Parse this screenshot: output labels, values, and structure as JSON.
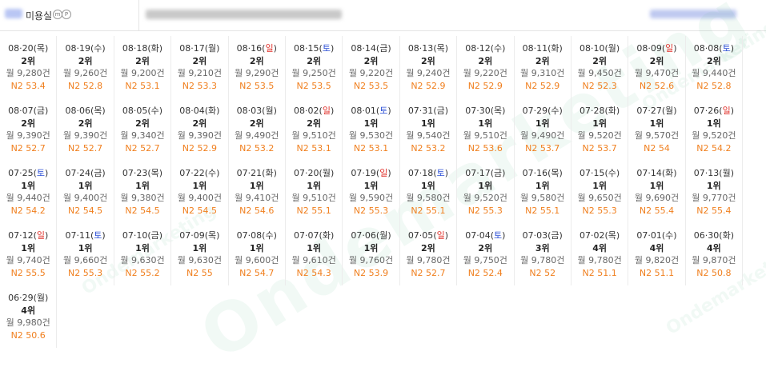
{
  "header": {
    "shop_name": "미용실",
    "badge_1": "m",
    "badge_2": "P"
  },
  "watermark": "Ondemarketing",
  "colors": {
    "rank_number": "#222222",
    "n2_value": "#f07f1e",
    "saturday": "#2c4fd6",
    "sunday": "#e0302a"
  },
  "records": [
    {
      "date": "08·20",
      "day": "목",
      "rank": "2위",
      "volume": "월 9,280건",
      "n2": "N2 53.4"
    },
    {
      "date": "08·19",
      "day": "수",
      "rank": "2위",
      "volume": "월 9,260건",
      "n2": "N2 52.8"
    },
    {
      "date": "08·18",
      "day": "화",
      "rank": "2위",
      "volume": "월 9,200건",
      "n2": "N2 53.1"
    },
    {
      "date": "08·17",
      "day": "월",
      "rank": "2위",
      "volume": "월 9,210건",
      "n2": "N2 53.3"
    },
    {
      "date": "08·16",
      "day": "일",
      "rank": "2위",
      "volume": "월 9,290건",
      "n2": "N2 53.5"
    },
    {
      "date": "08·15",
      "day": "토",
      "rank": "2위",
      "volume": "월 9,250건",
      "n2": "N2 53.5"
    },
    {
      "date": "08·14",
      "day": "금",
      "rank": "2위",
      "volume": "월 9,220건",
      "n2": "N2 53.5"
    },
    {
      "date": "08·13",
      "day": "목",
      "rank": "2위",
      "volume": "월 9,240건",
      "n2": "N2 52.9"
    },
    {
      "date": "08·12",
      "day": "수",
      "rank": "2위",
      "volume": "월 9,220건",
      "n2": "N2 52.9"
    },
    {
      "date": "08·11",
      "day": "화",
      "rank": "2위",
      "volume": "월 9,310건",
      "n2": "N2 52.9"
    },
    {
      "date": "08·10",
      "day": "월",
      "rank": "2위",
      "volume": "월 9,450건",
      "n2": "N2 52.3"
    },
    {
      "date": "08·09",
      "day": "일",
      "rank": "2위",
      "volume": "월 9,470건",
      "n2": "N2 52.6"
    },
    {
      "date": "08·08",
      "day": "토",
      "rank": "2위",
      "volume": "월 9,440건",
      "n2": "N2 52.8"
    },
    {
      "date": "08·07",
      "day": "금",
      "rank": "2위",
      "volume": "월 9,390건",
      "n2": "N2 52.7"
    },
    {
      "date": "08·06",
      "day": "목",
      "rank": "2위",
      "volume": "월 9,390건",
      "n2": "N2 52.7"
    },
    {
      "date": "08·05",
      "day": "수",
      "rank": "2위",
      "volume": "월 9,340건",
      "n2": "N2 52.7"
    },
    {
      "date": "08·04",
      "day": "화",
      "rank": "2위",
      "volume": "월 9,390건",
      "n2": "N2 52.9"
    },
    {
      "date": "08·03",
      "day": "월",
      "rank": "2위",
      "volume": "월 9,490건",
      "n2": "N2 53.2"
    },
    {
      "date": "08·02",
      "day": "일",
      "rank": "2위",
      "volume": "월 9,510건",
      "n2": "N2 53.1"
    },
    {
      "date": "08·01",
      "day": "토",
      "rank": "1위",
      "volume": "월 9,530건",
      "n2": "N2 53.1"
    },
    {
      "date": "07·31",
      "day": "금",
      "rank": "1위",
      "volume": "월 9,540건",
      "n2": "N2 53.2"
    },
    {
      "date": "07·30",
      "day": "목",
      "rank": "1위",
      "volume": "월 9,510건",
      "n2": "N2 53.6"
    },
    {
      "date": "07·29",
      "day": "수",
      "rank": "1위",
      "volume": "월 9,490건",
      "n2": "N2 53.7"
    },
    {
      "date": "07·28",
      "day": "화",
      "rank": "1위",
      "volume": "월 9,520건",
      "n2": "N2 53.7"
    },
    {
      "date": "07·27",
      "day": "월",
      "rank": "1위",
      "volume": "월 9,570건",
      "n2": "N2 54"
    },
    {
      "date": "07·26",
      "day": "일",
      "rank": "1위",
      "volume": "월 9,520건",
      "n2": "N2 54.2"
    },
    {
      "date": "07·25",
      "day": "토",
      "rank": "1위",
      "volume": "월 9,440건",
      "n2": "N2 54.2"
    },
    {
      "date": "07·24",
      "day": "금",
      "rank": "1위",
      "volume": "월 9,400건",
      "n2": "N2 54.5"
    },
    {
      "date": "07·23",
      "day": "목",
      "rank": "1위",
      "volume": "월 9,380건",
      "n2": "N2 54.5"
    },
    {
      "date": "07·22",
      "day": "수",
      "rank": "1위",
      "volume": "월 9,400건",
      "n2": "N2 54.5"
    },
    {
      "date": "07·21",
      "day": "화",
      "rank": "1위",
      "volume": "월 9,410건",
      "n2": "N2 54.6"
    },
    {
      "date": "07·20",
      "day": "월",
      "rank": "1위",
      "volume": "월 9,510건",
      "n2": "N2 55.1"
    },
    {
      "date": "07·19",
      "day": "일",
      "rank": "1위",
      "volume": "월 9,590건",
      "n2": "N2 55.3"
    },
    {
      "date": "07·18",
      "day": "토",
      "rank": "1위",
      "volume": "월 9,580건",
      "n2": "N2 55.1"
    },
    {
      "date": "07·17",
      "day": "금",
      "rank": "1위",
      "volume": "월 9,520건",
      "n2": "N2 55.3"
    },
    {
      "date": "07·16",
      "day": "목",
      "rank": "1위",
      "volume": "월 9,580건",
      "n2": "N2 55.1"
    },
    {
      "date": "07·15",
      "day": "수",
      "rank": "1위",
      "volume": "월 9,650건",
      "n2": "N2 55.3"
    },
    {
      "date": "07·14",
      "day": "화",
      "rank": "1위",
      "volume": "월 9,690건",
      "n2": "N2 55.4"
    },
    {
      "date": "07·13",
      "day": "월",
      "rank": "1위",
      "volume": "월 9,770건",
      "n2": "N2 55.4"
    },
    {
      "date": "07·12",
      "day": "일",
      "rank": "1위",
      "volume": "월 9,740건",
      "n2": "N2 55.5"
    },
    {
      "date": "07·11",
      "day": "토",
      "rank": "1위",
      "volume": "월 9,660건",
      "n2": "N2 55.3"
    },
    {
      "date": "07·10",
      "day": "금",
      "rank": "1위",
      "volume": "월 9,630건",
      "n2": "N2 55.2"
    },
    {
      "date": "07·09",
      "day": "목",
      "rank": "1위",
      "volume": "월 9,630건",
      "n2": "N2 55"
    },
    {
      "date": "07·08",
      "day": "수",
      "rank": "1위",
      "volume": "월 9,600건",
      "n2": "N2 54.7"
    },
    {
      "date": "07·07",
      "day": "화",
      "rank": "1위",
      "volume": "월 9,610건",
      "n2": "N2 54.3"
    },
    {
      "date": "07·06",
      "day": "월",
      "rank": "1위",
      "volume": "월 9,760건",
      "n2": "N2 53.9"
    },
    {
      "date": "07·05",
      "day": "일",
      "rank": "2위",
      "volume": "월 9,780건",
      "n2": "N2 52.7"
    },
    {
      "date": "07·04",
      "day": "토",
      "rank": "2위",
      "volume": "월 9,750건",
      "n2": "N2 52.4"
    },
    {
      "date": "07·03",
      "day": "금",
      "rank": "3위",
      "volume": "월 9,780건",
      "n2": "N2 52"
    },
    {
      "date": "07·02",
      "day": "목",
      "rank": "4위",
      "volume": "월 9,780건",
      "n2": "N2 51.1"
    },
    {
      "date": "07·01",
      "day": "수",
      "rank": "4위",
      "volume": "월 9,820건",
      "n2": "N2 51.1"
    },
    {
      "date": "06·30",
      "day": "화",
      "rank": "4위",
      "volume": "월 9,870건",
      "n2": "N2 50.8"
    },
    {
      "date": "06·29",
      "day": "월",
      "rank": "4위",
      "volume": "월 9,980건",
      "n2": "N2 50.6"
    }
  ]
}
